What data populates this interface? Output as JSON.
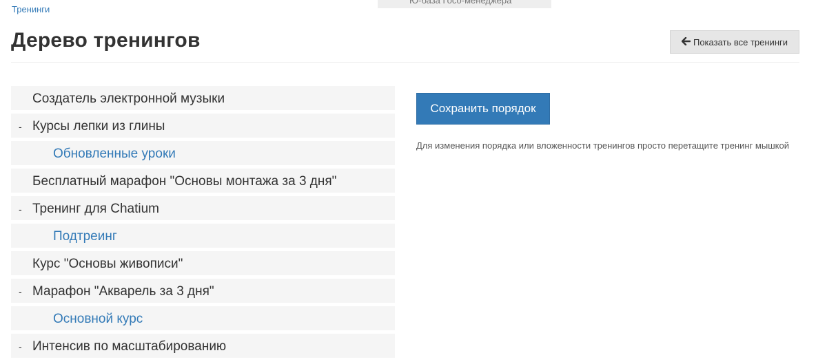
{
  "top_tab": {
    "label": "Ю-база Госо-менеджера"
  },
  "breadcrumb": {
    "label": "Тренинги"
  },
  "header": {
    "title": "Дерево тренингов",
    "show_all_label": "Показать все тренинги",
    "show_all_icon": "arrow-left-icon"
  },
  "tree": {
    "collapse_symbol": "-",
    "items": [
      {
        "label": "Создатель электронной музыки",
        "level": 0,
        "has_toggle": false
      },
      {
        "label": "Курсы лепки из глины",
        "level": 0,
        "has_toggle": true
      },
      {
        "label": "Обновленные уроки",
        "level": 1,
        "has_toggle": false
      },
      {
        "label": "Бесплатный марафон \"Основы монтажа за 3 дня\"",
        "level": 0,
        "has_toggle": false
      },
      {
        "label": "Тренинг для Chatium",
        "level": 0,
        "has_toggle": true
      },
      {
        "label": "Подтреинг",
        "level": 1,
        "has_toggle": false
      },
      {
        "label": "Курс \"Основы живописи\"",
        "level": 0,
        "has_toggle": false
      },
      {
        "label": "Марафон \"Акварель за 3 дня\"",
        "level": 0,
        "has_toggle": true
      },
      {
        "label": "Основной курс",
        "level": 1,
        "has_toggle": false
      },
      {
        "label": "Интенсив по масштабированию",
        "level": 0,
        "has_toggle": true
      }
    ]
  },
  "actions": {
    "save_label": "Сохранить порядок",
    "hint": "Для изменения порядка или вложенности тренингов просто перетащите тренинг мышкой"
  },
  "colors": {
    "accent": "#337ab7",
    "row_background": "#f5f5f5",
    "secondary_button": "#e6e6e6"
  }
}
